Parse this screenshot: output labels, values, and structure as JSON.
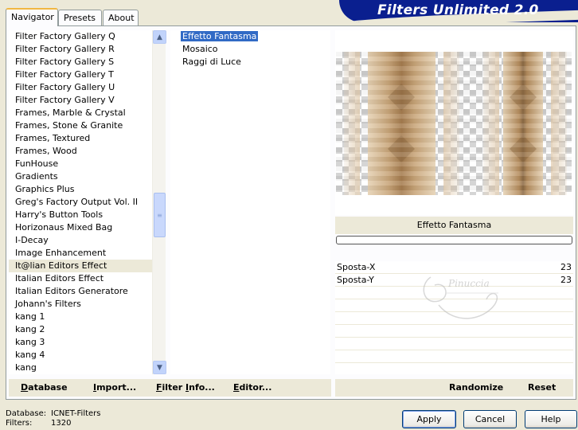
{
  "header": {
    "title": "Filters Unlimited 2.0"
  },
  "tabs": [
    {
      "label": "Navigator"
    },
    {
      "label": "Presets"
    },
    {
      "label": "About"
    }
  ],
  "categories": {
    "selected_index": 18,
    "items": [
      "Filter Factory Gallery Q",
      "Filter Factory Gallery R",
      "Filter Factory Gallery S",
      "Filter Factory Gallery T",
      "Filter Factory Gallery U",
      "Filter Factory Gallery V",
      "Frames, Marble & Crystal",
      "Frames, Stone & Granite",
      "Frames, Textured",
      "Frames, Wood",
      "FunHouse",
      "Gradients",
      "Graphics Plus",
      "Greg's Factory Output Vol. II",
      "Harry's Button Tools",
      "Horizonaus Mixed Bag",
      "I-Decay",
      "Image Enhancement",
      "It@lian Editors Effect",
      "Italian Editors Effect",
      "Italian Editors Generatore",
      "Johann's Filters",
      "kang 1",
      "kang 2",
      "kang 3",
      "kang 4",
      "kang"
    ]
  },
  "filters": {
    "selected_index": 0,
    "items": [
      "Effetto Fantasma",
      "Mosaico",
      "Raggi di Luce"
    ]
  },
  "preview": {
    "filter_name": "Effetto Fantasma"
  },
  "params": [
    {
      "name": "Sposta-X",
      "value": "23"
    },
    {
      "name": "Sposta-Y",
      "value": "23"
    }
  ],
  "toolbar": {
    "database": {
      "u": "D",
      "rest": "atabase"
    },
    "import": {
      "u": "I",
      "rest": "mport..."
    },
    "filter_info": {
      "u": "F",
      "mid": "ilter ",
      "u2": "I",
      "rest": "nfo..."
    },
    "editor": {
      "u": "E",
      "rest": "ditor..."
    },
    "randomize": "Randomize",
    "reset": "Reset"
  },
  "status": {
    "database_label": "Database:",
    "database_value": "ICNET-Filters",
    "filters_label": "Filters:",
    "filters_value": "1320"
  },
  "buttons": {
    "apply": "Apply",
    "cancel": "Cancel",
    "help": "Help"
  },
  "colors": {
    "banner": "#0a1f8f",
    "selection": "#316ac5",
    "panel": "#ece9d8"
  }
}
